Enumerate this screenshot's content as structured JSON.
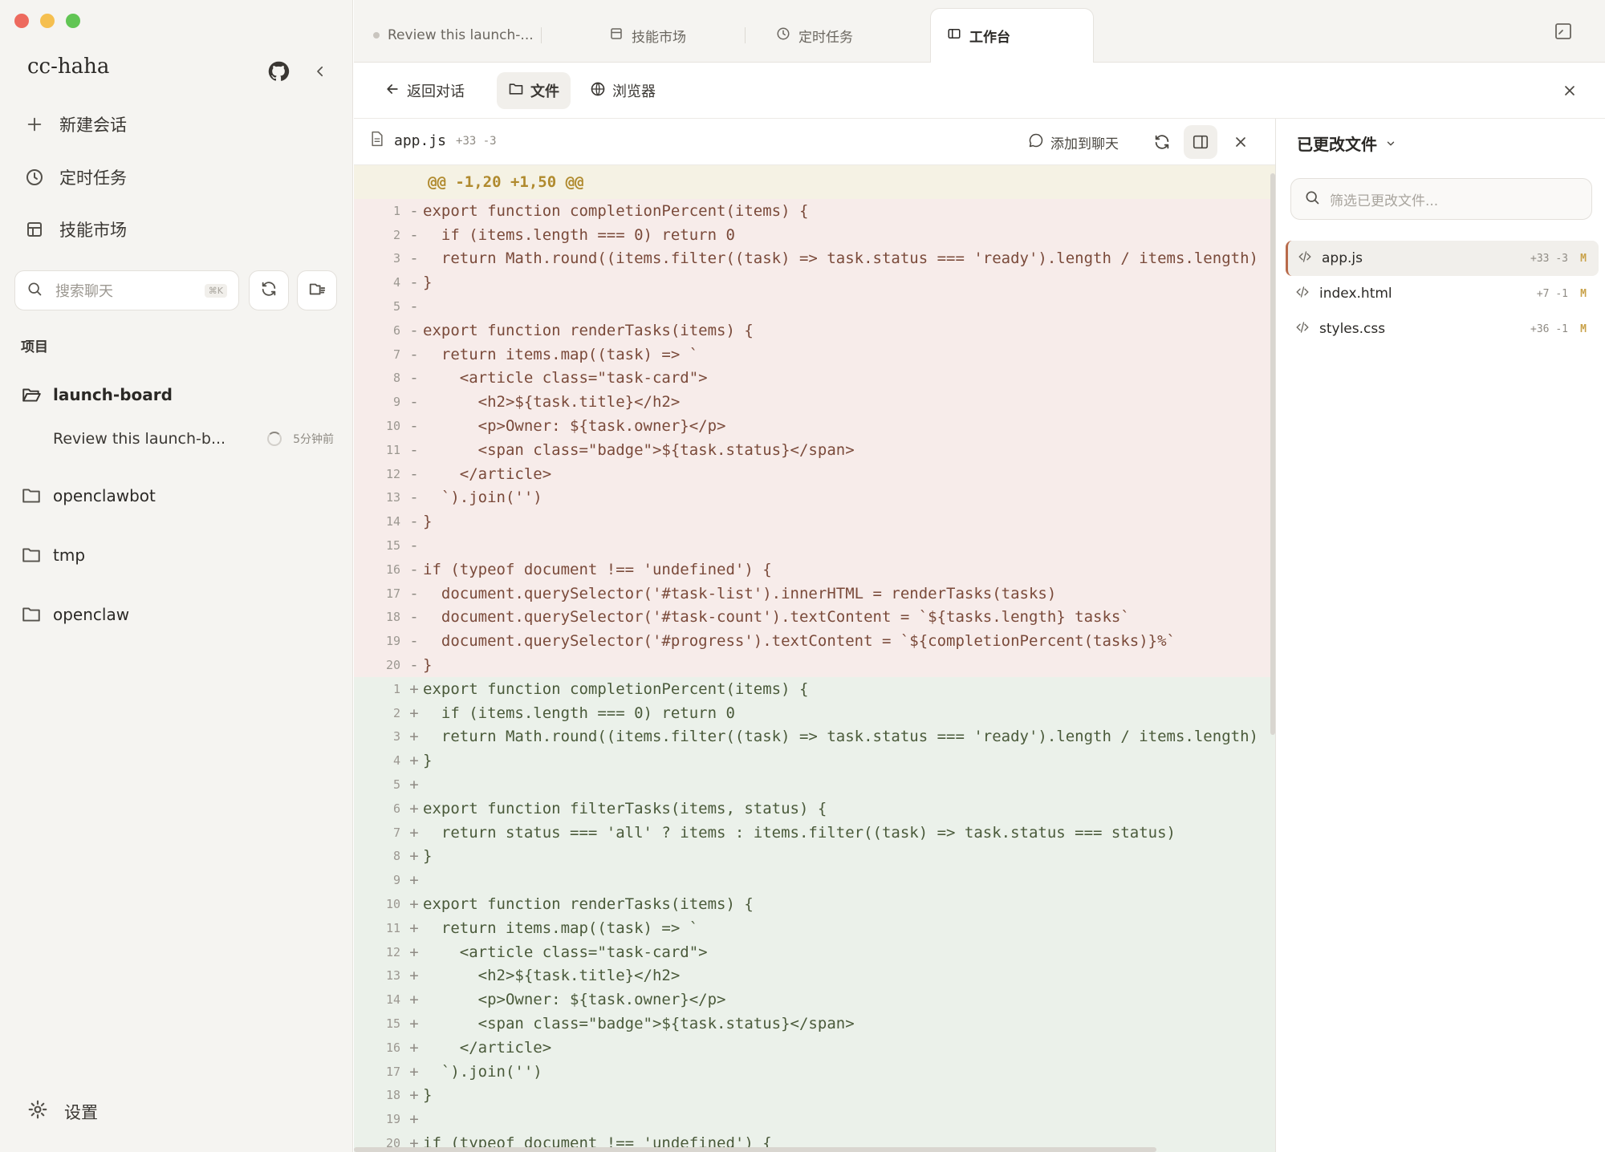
{
  "colors": {
    "traffic_close": "#ed6a5e",
    "traffic_min": "#f5bf4f",
    "traffic_max": "#61c554",
    "deleted_bg": "#f7ecea",
    "added_bg": "#ebf1ea",
    "hunk_bg": "#f5f2e4",
    "accent": "#b86a4a"
  },
  "sidebar": {
    "brand": "cc-haha",
    "github_icon": "github-icon",
    "collapse_icon": "chevron-left-icon",
    "nav": [
      {
        "label": "新建会话",
        "icon": "plus-icon"
      },
      {
        "label": "定时任务",
        "icon": "clock-icon"
      },
      {
        "label": "技能市场",
        "icon": "store-icon"
      }
    ],
    "search": {
      "placeholder": "搜索聊天",
      "shortcut": "⌘K"
    },
    "section": "项目",
    "projects": [
      {
        "name": "launch-board",
        "icon": "folder-open-icon"
      },
      {
        "name": "openclawbot",
        "icon": "folder-icon"
      },
      {
        "name": "tmp",
        "icon": "folder-icon"
      },
      {
        "name": "openclaw",
        "icon": "folder-icon"
      }
    ],
    "session": {
      "title": "Review this launch-b...",
      "time": "5分钟前"
    },
    "settings": "设置"
  },
  "tabs": [
    {
      "label": "Review this launch-...",
      "icon": "dot-icon"
    },
    {
      "label": "技能市场",
      "icon": "store-icon"
    },
    {
      "label": "定时任务",
      "icon": "clock-icon"
    },
    {
      "label": "工作台",
      "icon": "panel-icon",
      "active": true
    }
  ],
  "toolbar": {
    "back": "返回对话",
    "files": "文件",
    "browser": "浏览器"
  },
  "diff_header": {
    "file": "app.js",
    "stat": "+33 -3",
    "add_to_chat": "添加到聊天"
  },
  "diff": {
    "hunk": "@@ -1,20 +1,50 @@",
    "lines": [
      {
        "n": "1",
        "s": "-",
        "t": "del",
        "c": "export function completionPercent(items) {"
      },
      {
        "n": "2",
        "s": "-",
        "t": "del",
        "c": "  if (items.length === 0) return 0"
      },
      {
        "n": "3",
        "s": "-",
        "t": "del",
        "c": "  return Math.round((items.filter((task) => task.status === 'ready').length / items.length)"
      },
      {
        "n": "4",
        "s": "-",
        "t": "del",
        "c": "}"
      },
      {
        "n": "5",
        "s": "-",
        "t": "del",
        "c": ""
      },
      {
        "n": "6",
        "s": "-",
        "t": "del",
        "c": "export function renderTasks(items) {"
      },
      {
        "n": "7",
        "s": "-",
        "t": "del",
        "c": "  return items.map((task) => `"
      },
      {
        "n": "8",
        "s": "-",
        "t": "del",
        "c": "    <article class=\"task-card\">"
      },
      {
        "n": "9",
        "s": "-",
        "t": "del",
        "c": "      <h2>${task.title}</h2>"
      },
      {
        "n": "10",
        "s": "-",
        "t": "del",
        "c": "      <p>Owner: ${task.owner}</p>"
      },
      {
        "n": "11",
        "s": "-",
        "t": "del",
        "c": "      <span class=\"badge\">${task.status}</span>"
      },
      {
        "n": "12",
        "s": "-",
        "t": "del",
        "c": "    </article>"
      },
      {
        "n": "13",
        "s": "-",
        "t": "del",
        "c": "  `).join('')"
      },
      {
        "n": "14",
        "s": "-",
        "t": "del",
        "c": "}"
      },
      {
        "n": "15",
        "s": "-",
        "t": "del",
        "c": ""
      },
      {
        "n": "16",
        "s": "-",
        "t": "del",
        "c": "if (typeof document !== 'undefined') {"
      },
      {
        "n": "17",
        "s": "-",
        "t": "del",
        "c": "  document.querySelector('#task-list').innerHTML = renderTasks(tasks)"
      },
      {
        "n": "18",
        "s": "-",
        "t": "del",
        "c": "  document.querySelector('#task-count').textContent = `${tasks.length} tasks`"
      },
      {
        "n": "19",
        "s": "-",
        "t": "del",
        "c": "  document.querySelector('#progress').textContent = `${completionPercent(tasks)}%`"
      },
      {
        "n": "20",
        "s": "-",
        "t": "del",
        "c": "}"
      },
      {
        "n": "1",
        "s": "+",
        "t": "add",
        "c": "export function completionPercent(items) {"
      },
      {
        "n": "2",
        "s": "+",
        "t": "add",
        "c": "  if (items.length === 0) return 0"
      },
      {
        "n": "3",
        "s": "+",
        "t": "add",
        "c": "  return Math.round((items.filter((task) => task.status === 'ready').length / items.length)"
      },
      {
        "n": "4",
        "s": "+",
        "t": "add",
        "c": "}"
      },
      {
        "n": "5",
        "s": "+",
        "t": "add",
        "c": ""
      },
      {
        "n": "6",
        "s": "+",
        "t": "add",
        "c": "export function filterTasks(items, status) {"
      },
      {
        "n": "7",
        "s": "+",
        "t": "add",
        "c": "  return status === 'all' ? items : items.filter((task) => task.status === status)"
      },
      {
        "n": "8",
        "s": "+",
        "t": "add",
        "c": "}"
      },
      {
        "n": "9",
        "s": "+",
        "t": "add",
        "c": ""
      },
      {
        "n": "10",
        "s": "+",
        "t": "add",
        "c": "export function renderTasks(items) {"
      },
      {
        "n": "11",
        "s": "+",
        "t": "add",
        "c": "  return items.map((task) => `"
      },
      {
        "n": "12",
        "s": "+",
        "t": "add",
        "c": "    <article class=\"task-card\">"
      },
      {
        "n": "13",
        "s": "+",
        "t": "add",
        "c": "      <h2>${task.title}</h2>"
      },
      {
        "n": "14",
        "s": "+",
        "t": "add",
        "c": "      <p>Owner: ${task.owner}</p>"
      },
      {
        "n": "15",
        "s": "+",
        "t": "add",
        "c": "      <span class=\"badge\">${task.status}</span>"
      },
      {
        "n": "16",
        "s": "+",
        "t": "add",
        "c": "    </article>"
      },
      {
        "n": "17",
        "s": "+",
        "t": "add",
        "c": "  `).join('')"
      },
      {
        "n": "18",
        "s": "+",
        "t": "add",
        "c": "}"
      },
      {
        "n": "19",
        "s": "+",
        "t": "add",
        "c": ""
      },
      {
        "n": "20",
        "s": "+",
        "t": "add",
        "c": "if (typeof document !== 'undefined') {"
      }
    ]
  },
  "right_panel": {
    "title": "已更改文件",
    "filter_placeholder": "筛选已更改文件...",
    "files": [
      {
        "name": "app.js",
        "stat": "+33 -3",
        "mark": "M",
        "active": true
      },
      {
        "name": "index.html",
        "stat": "+7 -1",
        "mark": "M"
      },
      {
        "name": "styles.css",
        "stat": "+36 -1",
        "mark": "M"
      }
    ]
  }
}
